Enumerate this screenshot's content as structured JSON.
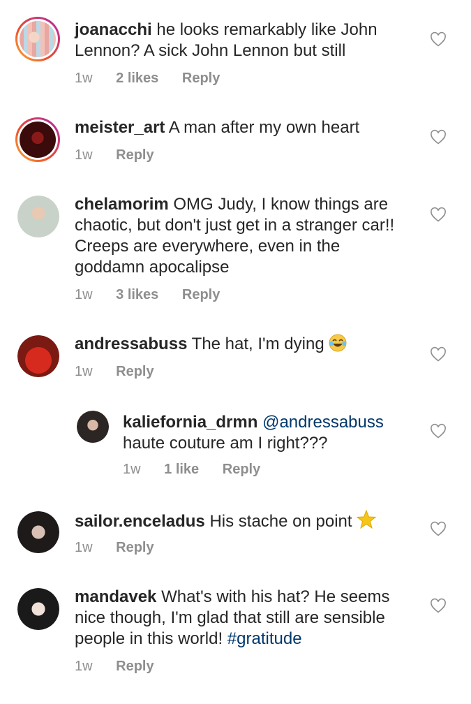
{
  "comments": [
    {
      "username": "joanacchi",
      "text": "he looks remarkably like John Lennon? A sick John Lennon but still",
      "time": "1w",
      "likes": "2 likes",
      "reply": "Reply"
    },
    {
      "username": "meister_art",
      "text": "A man after my own heart",
      "time": "1w",
      "reply": "Reply"
    },
    {
      "username": "chelamorim",
      "text": "OMG Judy, I know things are chaotic, but don't just get in a stranger car!! Creeps are everywhere, even in the goddamn apocalipse",
      "time": "1w",
      "likes": "3 likes",
      "reply": "Reply"
    },
    {
      "username": "andressabuss",
      "text": "The hat, I'm dying",
      "emoji": "laughing-tears-emoji",
      "time": "1w",
      "reply": "Reply"
    },
    {
      "username": "kaliefornia_drmn",
      "mention": "@andressabuss",
      "text": "haute couture am I right???",
      "time": "1w",
      "likes": "1 like",
      "reply": "Reply"
    },
    {
      "username": "sailor.enceladus",
      "text": "His stache on point",
      "emoji": "star-emoji",
      "time": "1w",
      "reply": "Reply"
    },
    {
      "username": "mandavek",
      "text": "What's with his hat? He seems nice though, I'm glad that still are sensible people in this world!",
      "hashtag": "#gratitude",
      "time": "1w",
      "reply": "Reply"
    }
  ],
  "colors": {
    "text": "#262626",
    "meta": "#8e8e8e",
    "link": "#00376b"
  }
}
